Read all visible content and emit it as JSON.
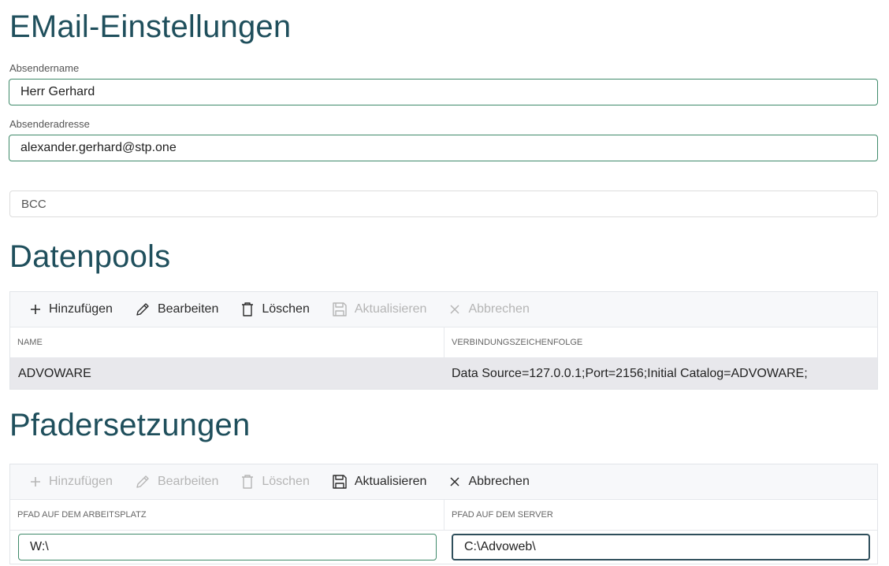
{
  "email": {
    "title": "EMail-Einstellungen",
    "sender_name_label": "Absendername",
    "sender_name_value": "Herr Gerhard",
    "sender_address_label": "Absenderadresse",
    "sender_address_value": "alexander.gerhard@stp.one",
    "bcc_placeholder": "BCC"
  },
  "datapools": {
    "title": "Datenpools",
    "toolbar": {
      "add": "Hinzufügen",
      "edit": "Bearbeiten",
      "delete": "Löschen",
      "update": "Aktualisieren",
      "cancel": "Abbrechen"
    },
    "columns": [
      "NAME",
      "VERBINDUNGSZEICHENFOLGE"
    ],
    "rows": [
      [
        "ADVOWARE",
        "Data Source=127.0.0.1;Port=2156;Initial Catalog=ADVOWARE;"
      ]
    ]
  },
  "paths": {
    "title": "Pfadersetzungen",
    "toolbar": {
      "add": "Hinzufügen",
      "edit": "Bearbeiten",
      "delete": "Löschen",
      "update": "Aktualisieren",
      "cancel": "Abbrechen"
    },
    "columns": [
      "PFAD AUF DEM ARBEITSPLATZ",
      "PFAD AUF DEM SERVER"
    ],
    "edit_row": [
      "W:\\",
      "C:\\Advoweb\\"
    ]
  },
  "colors": {
    "heading": "#1f4f5c",
    "focus_border": "#3f8a6a",
    "row_bg": "#e8e8ec",
    "toolbar_bg": "#f7f8fa"
  }
}
